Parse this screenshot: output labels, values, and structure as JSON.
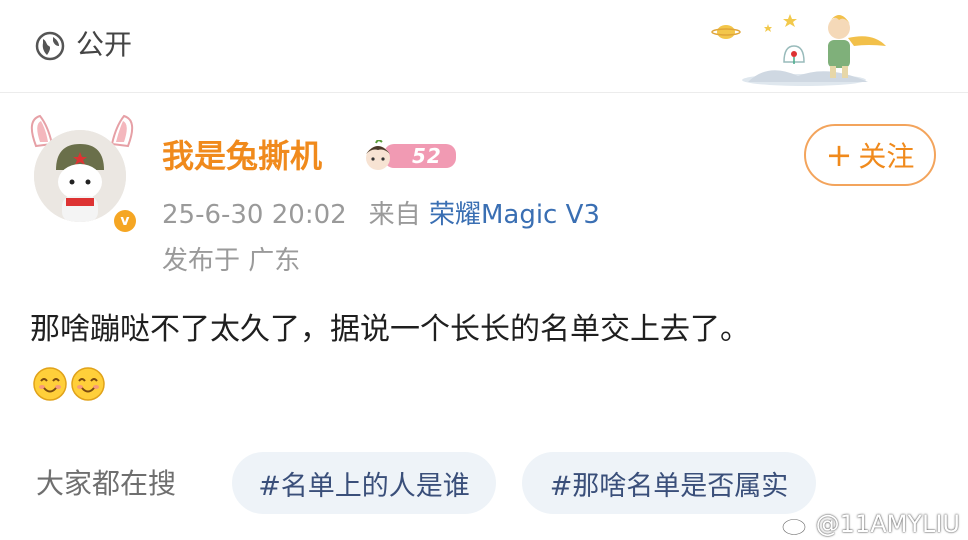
{
  "header": {
    "visibility": "公开",
    "visibility_icon": "globe-icon",
    "decoration": "little-prince-illustration"
  },
  "author": {
    "name": "我是兔撕机",
    "level": "52",
    "verified_icon": "verified-badge-icon",
    "verified_mark": "v",
    "avatar": "mi-bunny-avatar"
  },
  "actions": {
    "follow_plus": "+",
    "follow_label": "关注"
  },
  "post": {
    "time": "25-6-30 20:02",
    "source_prefix": "来自",
    "source_device": "荣耀Magic V3",
    "location": "发布于 广东",
    "text": "那啥蹦哒不了太久了，据说一个长长的名单交上去了。",
    "emojis": [
      "smile-emoji",
      "smile-emoji"
    ]
  },
  "trending": {
    "label": "大家都在搜",
    "tags": [
      "#名单上的人是谁",
      "#那啥名单是否属实"
    ]
  },
  "watermark": {
    "text": "@11AMYLIU"
  },
  "colors": {
    "username": "#f08a1c",
    "link": "#3a6fb3",
    "follow_border": "#f3a45c",
    "tag_bg": "#eef3f8"
  }
}
